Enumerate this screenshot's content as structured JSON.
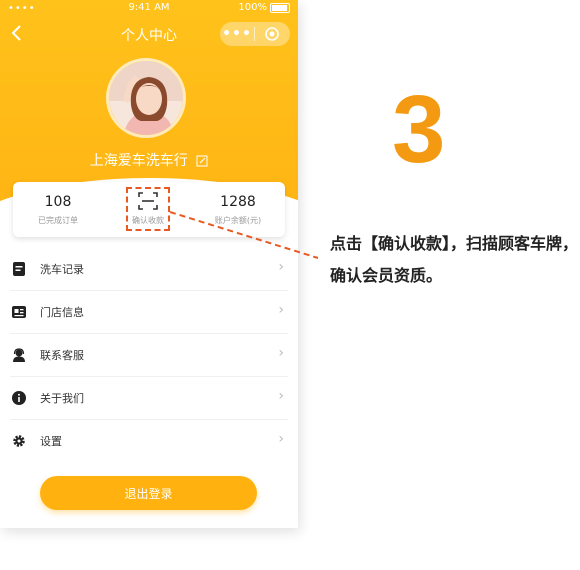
{
  "status_bar": {
    "signal": "•••• ",
    "time": "9:41 AM",
    "battery": "100%"
  },
  "navbar": {
    "back_icon": "chevron-left-icon",
    "title": "个人中心",
    "menu_icon": "more-dots-icon",
    "close_icon": "target-icon"
  },
  "profile": {
    "shop_name": "上海爱车洗车行",
    "edit_icon": "edit-icon"
  },
  "stats": {
    "completed_orders": {
      "value": "108",
      "label": "已完成订单"
    },
    "confirm_payment": {
      "label": "确认收款",
      "icon": "scan-icon"
    },
    "balance": {
      "value": "1288",
      "label": "账户余额(元)"
    }
  },
  "menu": [
    {
      "label": "洗车记录",
      "icon": "record-icon"
    },
    {
      "label": "门店信息",
      "icon": "store-card-icon"
    },
    {
      "label": "联系客服",
      "icon": "customer-service-icon"
    },
    {
      "label": "关于我们",
      "icon": "info-icon"
    },
    {
      "label": "设置",
      "icon": "gear-icon"
    }
  ],
  "logout_label": "退出登录",
  "step_number": "3",
  "instruction": "点击【确认收款】，扫描顾客车牌，确认会员资质。",
  "colors": {
    "primary": "#ffb514",
    "accent": "#e85a23",
    "step": "#f39a12"
  }
}
